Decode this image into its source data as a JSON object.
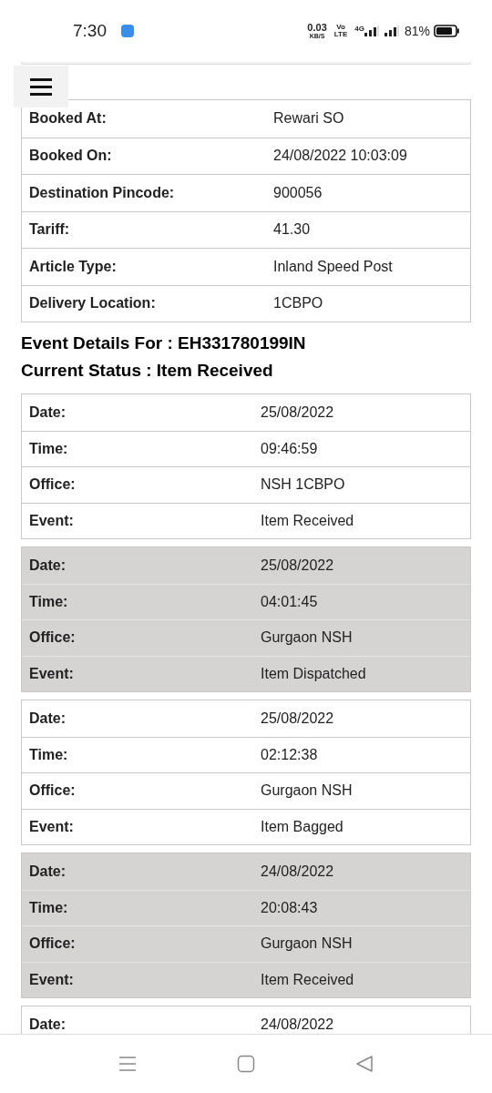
{
  "status_bar": {
    "time": "7:30",
    "speed_value": "0.03",
    "speed_unit": "KB/S",
    "volte_top": "Vo",
    "volte_bottom": "LTE",
    "network": "4G",
    "battery": "81%"
  },
  "details": [
    {
      "label": "Booked At:",
      "value": "Rewari SO"
    },
    {
      "label": "Booked On:",
      "value": "24/08/2022 10:03:09"
    },
    {
      "label": "Destination Pincode:",
      "value": "900056"
    },
    {
      "label": "Tariff:",
      "value": "41.30"
    },
    {
      "label": "Article Type:",
      "value": "Inland Speed Post"
    },
    {
      "label": "Delivery Location:",
      "value": "1CBPO"
    }
  ],
  "event_heading": "Event Details For : EH331780199IN",
  "status_heading": "Current Status : Item Received",
  "events": [
    {
      "shaded": false,
      "rows": [
        {
          "label": "Date:",
          "value": "25/08/2022"
        },
        {
          "label": "Time:",
          "value": "09:46:59"
        },
        {
          "label": "Office:",
          "value": "NSH 1CBPO"
        },
        {
          "label": "Event:",
          "value": "Item Received"
        }
      ]
    },
    {
      "shaded": true,
      "rows": [
        {
          "label": "Date:",
          "value": "25/08/2022"
        },
        {
          "label": "Time:",
          "value": "04:01:45"
        },
        {
          "label": "Office:",
          "value": "Gurgaon NSH"
        },
        {
          "label": "Event:",
          "value": "Item Dispatched"
        }
      ]
    },
    {
      "shaded": false,
      "rows": [
        {
          "label": "Date:",
          "value": "25/08/2022"
        },
        {
          "label": "Time:",
          "value": "02:12:38"
        },
        {
          "label": "Office:",
          "value": "Gurgaon NSH"
        },
        {
          "label": "Event:",
          "value": "Item Bagged"
        }
      ]
    },
    {
      "shaded": true,
      "rows": [
        {
          "label": "Date:",
          "value": "24/08/2022"
        },
        {
          "label": "Time:",
          "value": "20:08:43"
        },
        {
          "label": "Office:",
          "value": "Gurgaon NSH"
        },
        {
          "label": "Event:",
          "value": "Item Received"
        }
      ]
    },
    {
      "shaded": false,
      "rows": [
        {
          "label": "Date:",
          "value": "24/08/2022"
        }
      ]
    }
  ]
}
